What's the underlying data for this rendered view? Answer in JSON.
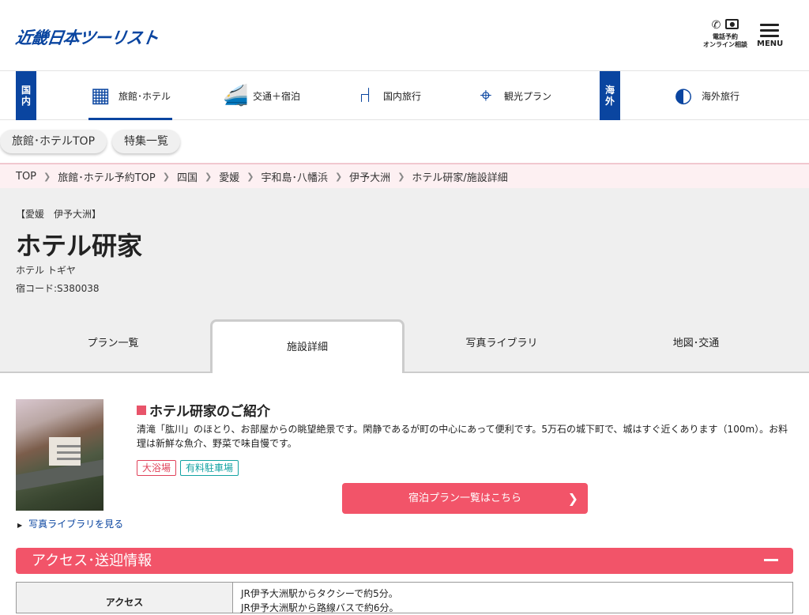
{
  "header": {
    "logo": "近畿日本ツーリスト",
    "tel_label_1": "電話予約",
    "tel_label_2": "オンライン相談",
    "menu_label": "MENU"
  },
  "category_nav": {
    "domestic_label": [
      "国",
      "内"
    ],
    "overseas_label": [
      "海",
      "外"
    ],
    "items": [
      {
        "label": "旅館･ホテル",
        "icon": "building-icon"
      },
      {
        "label": "交通＋宿泊",
        "icon": "train-building-icon"
      },
      {
        "label": "国内旅行",
        "icon": "seat-icon"
      },
      {
        "label": "観光プラン",
        "icon": "map-pin-icon"
      },
      {
        "label": "海外旅行",
        "icon": "globe-plane-icon"
      }
    ]
  },
  "sub_nav": [
    "旅館･ホテルTOP",
    "特集一覧"
  ],
  "breadcrumbs": [
    "TOP",
    "旅館･ホテル予約TOP",
    "四国",
    "愛媛",
    "宇和島･八幡浜",
    "伊予大洲",
    "ホテル研家/施設詳細"
  ],
  "hotel": {
    "area": "【愛媛　伊予大洲】",
    "name": "ホテル研家",
    "kana": "ホテル トギヤ",
    "code": "宿コード:S380038"
  },
  "tabs": [
    "プラン一覧",
    "施設詳細",
    "写真ライブラリ",
    "地図･交通"
  ],
  "intro": {
    "title": "ホテル研家のご紹介",
    "text": "清滝「肱川」のほとり、お部屋からの眺望絶景です。閑静であるが町の中心にあって便利です。5万石の城下町で、城はすぐ近くあります（100m）。お料理は新鮮な魚介、野菜で味自慢です。",
    "tags": [
      "大浴場",
      "有料駐車場"
    ],
    "photo_link": "写真ライブラリを見る",
    "plan_button": "宿泊プラン一覧はこちら"
  },
  "access": {
    "title": "アクセス･送迎情報",
    "row_header": "アクセス",
    "lines": [
      "JR伊予大洲駅からタクシーで約5分。",
      "JR伊予大洲駅から路線バスで約6分。"
    ]
  },
  "colors": {
    "brand_blue": "#0a45a0",
    "accent_pink": "#f25469"
  }
}
